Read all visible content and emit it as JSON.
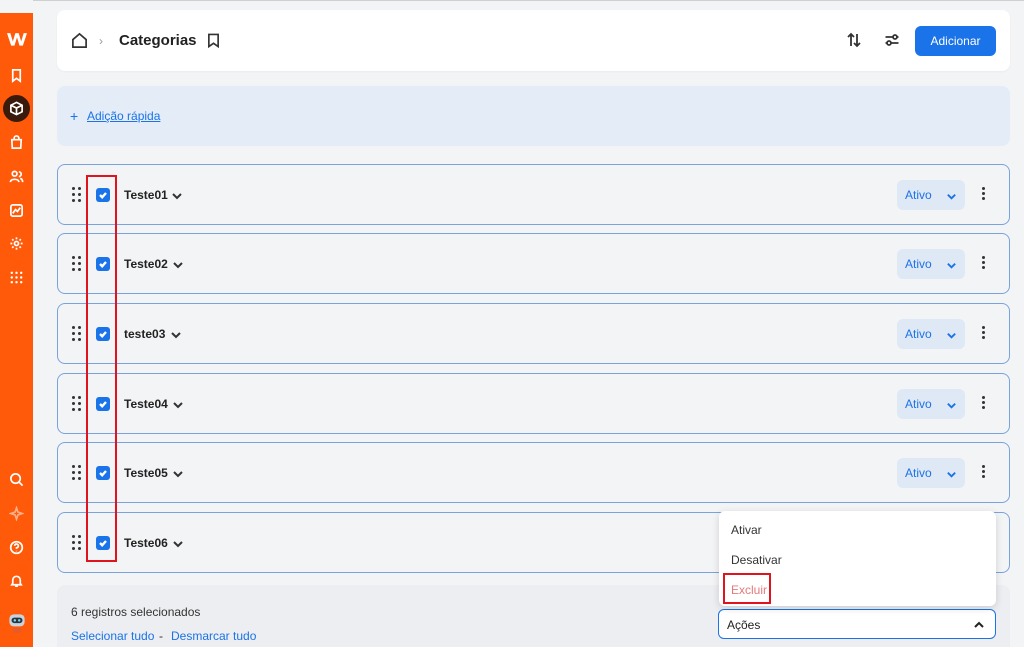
{
  "header": {
    "title": "Categorias",
    "add_label": "Adicionar"
  },
  "quick_add": {
    "label": "Adição rápida"
  },
  "rows": [
    {
      "name": "Teste01",
      "status": "Ativo",
      "checked": true
    },
    {
      "name": "Teste02",
      "status": "Ativo",
      "checked": true
    },
    {
      "name": "teste03",
      "status": "Ativo",
      "checked": true
    },
    {
      "name": "Teste04",
      "status": "Ativo",
      "checked": true
    },
    {
      "name": "Teste05",
      "status": "Ativo",
      "checked": true
    },
    {
      "name": "Teste06",
      "checked": true
    }
  ],
  "footer": {
    "selected_count": "6 registros selecionados",
    "select_all": "Selecionar tudo",
    "separator": "-",
    "deselect_all": "Desmarcar tudo",
    "actions_label": "Ações"
  },
  "actions_menu": {
    "options": [
      "Ativar",
      "Desativar",
      "Excluir"
    ]
  },
  "colors": {
    "sidebar": "#ff5a0a",
    "primary": "#1a73e8",
    "highlight": "#e0141e",
    "danger_text": "#e37a7a"
  },
  "sidebar_icons": [
    "logo-icon",
    "bookmark-icon",
    "box-icon",
    "bag-icon",
    "users-icon",
    "chart-icon",
    "gear-icon",
    "apps-icon",
    "search-icon",
    "sparkle-icon",
    "help-icon",
    "bell-icon",
    "avatar"
  ]
}
